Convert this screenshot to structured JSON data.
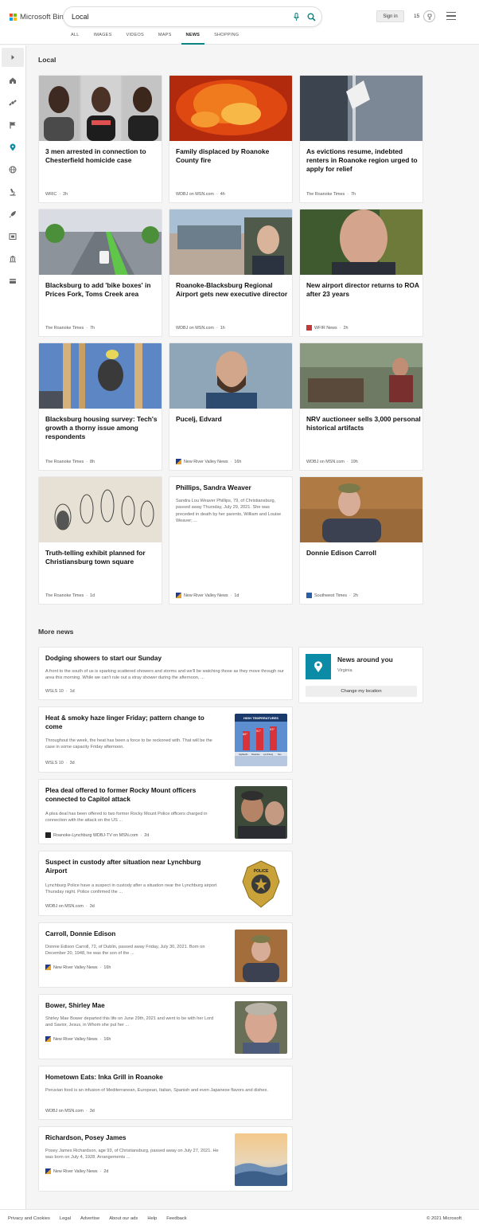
{
  "header": {
    "brand": "Microsoft Bing",
    "search_value": "Local",
    "sign_in": "Sign in",
    "rewards_count": "15"
  },
  "tabs": [
    "ALL",
    "IMAGES",
    "VIDEOS",
    "MAPS",
    "NEWS",
    "SHOPPING"
  ],
  "active_tab": "NEWS",
  "sidebar_icons": [
    "chevron-right-icon",
    "home-icon",
    "satellite-icon",
    "flag-icon",
    "location-pin-icon",
    "globe-icon",
    "microscope-icon",
    "rocket-icon",
    "film-icon",
    "bank-icon",
    "credit-card-icon"
  ],
  "local": {
    "heading": "Local",
    "cards": [
      {
        "title": "3 men arrested in connection to Chesterfield homicide case",
        "source": "WRIC",
        "age": "2h"
      },
      {
        "title": "Family displaced by Roanoke County fire",
        "source": "WDBJ on MSN.com",
        "age": "4h"
      },
      {
        "title": "As evictions resume, indebted renters in Roanoke region urged to apply for relief",
        "source": "The Roanoke Times",
        "age": "7h"
      },
      {
        "title": "Blacksburg to add 'bike boxes' in Prices Fork, Toms Creek area",
        "source": "The Roanoke Times",
        "age": "7h"
      },
      {
        "title": "Roanoke-Blacksburg Regional Airport gets new executive director",
        "source": "WDBJ on MSN.com",
        "age": "1h"
      },
      {
        "title": "New airport director returns to ROA after 23 years",
        "source": "WFIR News",
        "age": "2h"
      },
      {
        "title": "Blacksburg housing survey: Tech's growth a thorny issue among respondents",
        "source": "The Roanoke Times",
        "age": "8h"
      },
      {
        "title": "Pucelj, Edvard",
        "source": "New River Valley News",
        "age": "16h"
      },
      {
        "title": "NRV auctioneer sells 3,000 personal historical artifacts",
        "source": "WDBJ on MSN.com",
        "age": "19h"
      },
      {
        "title": "Truth-telling exhibit planned for Christiansburg town square",
        "source": "The Roanoke Times",
        "age": "1d"
      },
      {
        "title": "Phillips, Sandra Weaver",
        "snippet": "Sandra Lou Weaver Phillips, 79, of Christiansburg, passed away Thursday, July 29, 2021. She was preceded in death by her parents, William and Louise Weaver; ...",
        "source": "New River Valley News",
        "age": "1d"
      },
      {
        "title": "Donnie Edison Carroll",
        "source": "Southwest Times",
        "age": "2h"
      }
    ]
  },
  "more_news": {
    "heading": "More news",
    "items": [
      {
        "title": "Dodging showers to start our Sunday",
        "snippet": "A front to the south of us is sparking scattered showers and storms and we'll be watching those as they move through our area this morning. While we can't rule out a stray shower during the afternoon, ...",
        "source": "WSLS 10",
        "age": "1d"
      },
      {
        "title": "Heat & smoky haze linger Friday; pattern change to come",
        "snippet": "Throughout the week, the heat has been a force to be reckoned with. That will be the case in some capacity Friday afternoon.",
        "source": "WSLS 10",
        "age": "3d",
        "thumb_text": "HIGH TEMPERATURES",
        "temps": [
          "86°",
          "91°",
          "93°"
        ],
        "places": [
          "Highlands",
          "Roanoke",
          "Lynchburg",
          "Sou"
        ]
      },
      {
        "title": "Plea deal offered to former Rocky Mount officers connected to Capitol attack",
        "snippet": "A plea deal has been offered to two former Rocky Mount Police officers charged in connection with the attack on the US ...",
        "source": "Roanoke-Lynchburg WDBJ-TV on MSN.com",
        "age": "2d"
      },
      {
        "title": "Suspect in custody after situation near Lynchburg Airport",
        "snippet": "Lynchburg Police have a suspect in custody after a situation near the Lynchburg airport Thursday night. Police confirmed the ...",
        "source": "WDBJ on MSN.com",
        "age": "3d",
        "badge_text": "POLICE"
      },
      {
        "title": "Carroll, Donnie Edison",
        "snippet": "Donnie Edison Carroll, 72, of Dublin, passed away Friday, July 30, 2021. Born on December 20, 1948, he was the son of the ...",
        "source": "New River Valley News",
        "age": "16h"
      },
      {
        "title": "Bower, Shirley Mae",
        "snippet": "Shirley Mae Bower departed this life on June 29th, 2021 and went to be with her Lord and Savior, Jesus, in Whom she put her ...",
        "source": "New River Valley News",
        "age": "16h"
      },
      {
        "title": "Hometown Eats: Inka Grill in Roanoke",
        "snippet": "Peruvian food is an infusion of Mediterranean, European, Italian, Spanish and even Japanese flavors and dishes.",
        "source": "WDBJ on MSN.com",
        "age": "3d"
      },
      {
        "title": "Richardson, Posey James",
        "snippet": "Posey James Richardson, age 93, of Christiansburg, passed away on July 27, 2021. He was born on July 4, 1928. Arrangements ...",
        "source": "New River Valley News",
        "age": "2d"
      }
    ]
  },
  "news_around_you": {
    "title": "News around you",
    "region": "Virginia",
    "button": "Change my location"
  },
  "footer": {
    "links": [
      "Privacy and Cookies",
      "Legal",
      "Advertise",
      "About our ads",
      "Help",
      "Feedback"
    ],
    "copyright": "© 2021 Microsoft"
  },
  "colors": {
    "accent": "#0c8484",
    "pin": "#0c8ba6",
    "logo": [
      "#f25022",
      "#7fba00",
      "#00a4ef",
      "#ffb900"
    ]
  }
}
